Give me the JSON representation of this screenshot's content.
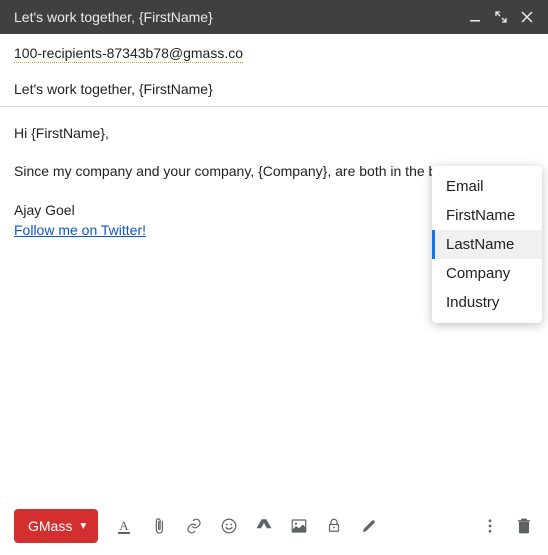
{
  "header": {
    "title": "Let's work together, {FirstName}"
  },
  "recipients": "100-recipients-87343b78@gmass.co",
  "subject": "Let's work together, {FirstName}",
  "body": {
    "greeting": "Hi {FirstName},",
    "paragraph": "Since my company and your company, {Company}, are both in the business of {",
    "signature_name": "Ajay Goel",
    "twitter_link_text": "Follow me on Twitter!"
  },
  "autocomplete": {
    "items": [
      "Email",
      "FirstName",
      "LastName",
      "Company",
      "Industry"
    ],
    "selected_index": 2
  },
  "toolbar": {
    "gmass_label": "GMass"
  }
}
